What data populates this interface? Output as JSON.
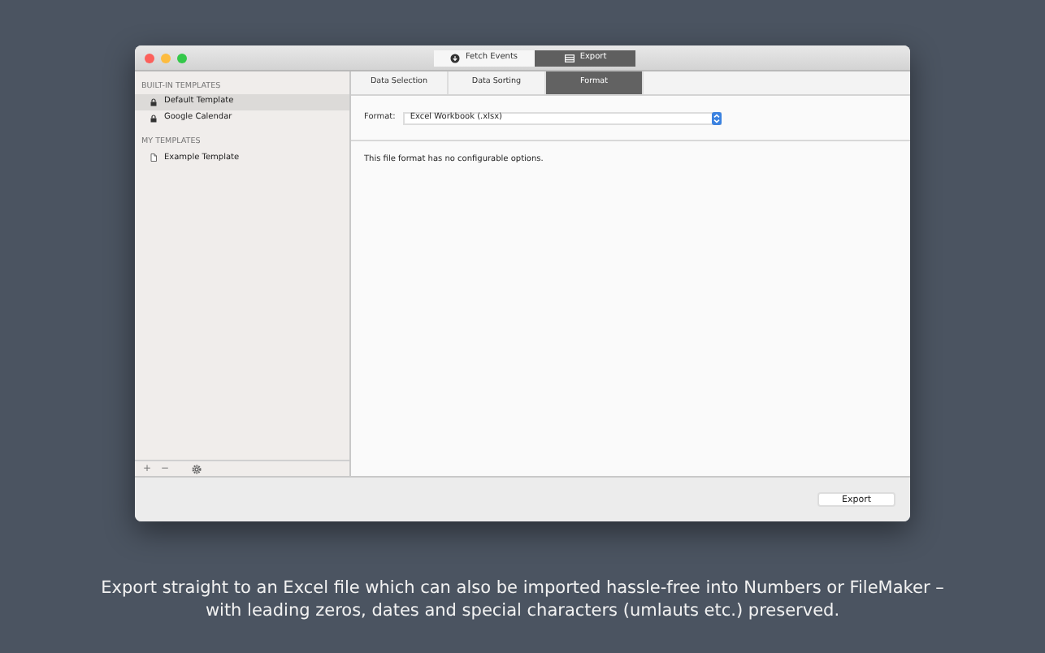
{
  "toolbar": [
    {
      "label": "Fetch Events",
      "kind": "fetch",
      "selected": false
    },
    {
      "label": "Export",
      "kind": "export",
      "selected": true
    }
  ],
  "sidebar": {
    "sections": [
      {
        "title": "BUILT-IN TEMPLATES",
        "items": [
          {
            "label": "Default Template",
            "kind": "lock",
            "selected": true
          },
          {
            "label": "Google Calendar",
            "kind": "lock",
            "selected": false
          }
        ]
      },
      {
        "title": "MY TEMPLATES",
        "items": [
          {
            "label": "Example Template",
            "kind": "document",
            "selected": false
          }
        ]
      }
    ],
    "footer": [
      {
        "label": "+",
        "kind": "add"
      },
      {
        "label": "−",
        "kind": "remove"
      },
      {
        "kind": "gear"
      }
    ]
  },
  "tabs": [
    {
      "label": "Data Selection",
      "selected": false
    },
    {
      "label": "Data Sorting",
      "selected": false
    },
    {
      "label": "Format",
      "selected": true
    }
  ],
  "format": {
    "label": "Format:",
    "value": "Excel Workbook (.xlsx)"
  },
  "message": "This file format has no configurable options.",
  "export_button": "Export",
  "caption": [
    "Export straight to an Excel file which can also be imported hassle-free into Numbers or FileMaker –",
    "with leading zeros, dates and special characters (umlauts etc.) preserved."
  ]
}
